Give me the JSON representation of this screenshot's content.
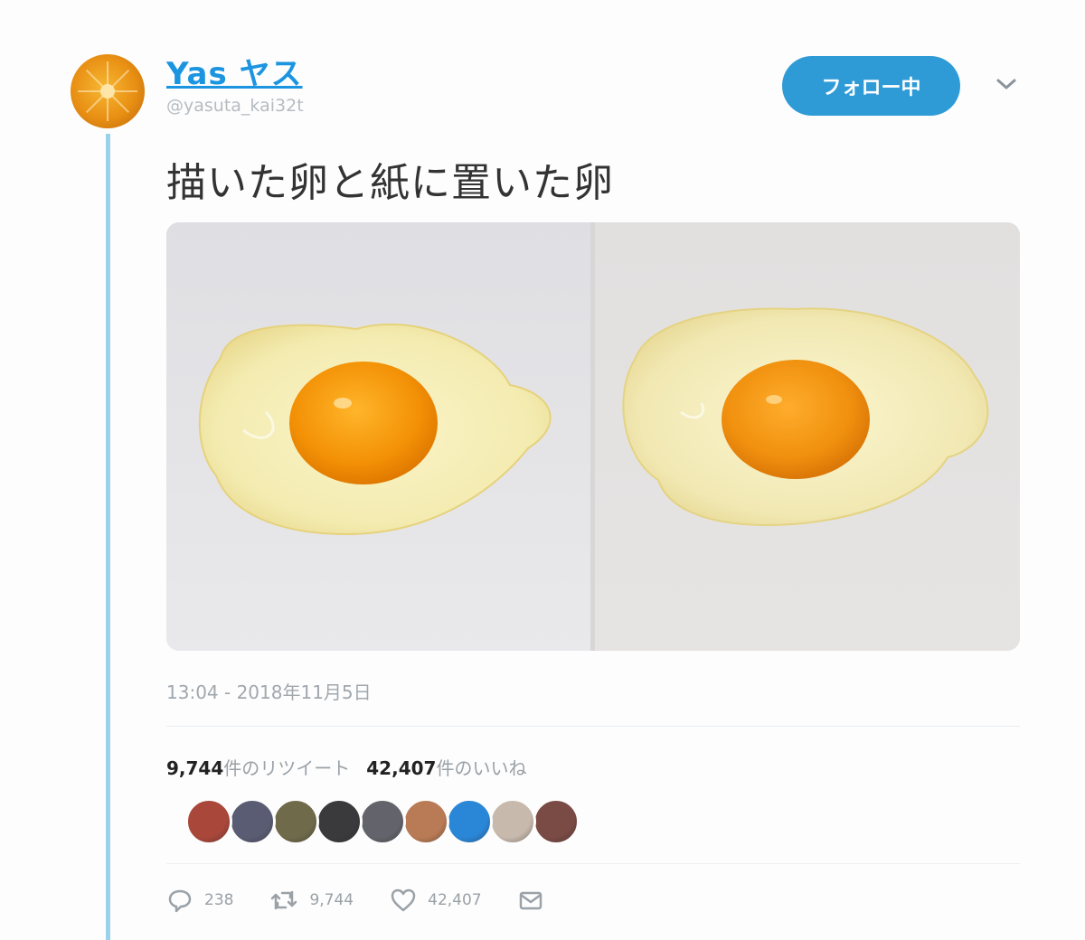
{
  "tweet": {
    "display_name": "Yas ヤス",
    "handle": "@yasuta_kai32t",
    "follow_label": "フォロー中",
    "text": "描いた卵と紙に置いた卵",
    "timestamp": "13:04 - 2018年11月5日"
  },
  "stats": {
    "retweets_count": "9,744",
    "retweets_suffix": "件のリツイート",
    "likes_count": "42,407",
    "likes_suffix": "件のいいね"
  },
  "likers": [
    {
      "color": "#a9473a"
    },
    {
      "color": "#5a5c73"
    },
    {
      "color": "#6f6a4a"
    },
    {
      "color": "#3a3a3d"
    },
    {
      "color": "#63646b"
    },
    {
      "color": "#b97b55"
    },
    {
      "color": "#2a86d6"
    },
    {
      "color": "#c8b9ad"
    },
    {
      "color": "#7a4a44"
    }
  ],
  "actions": {
    "replies": "238",
    "retweets": "9,744",
    "likes": "42,407"
  },
  "colors": {
    "accent": "#1b95e0",
    "follow_button": "#2f9bd6",
    "thread_line": "#9bd2ea",
    "yolk": "#f39c12"
  },
  "icons": {
    "reply": "reply-icon",
    "retweet": "retweet-icon",
    "like": "heart-icon",
    "message": "envelope-icon",
    "more": "chevron-down-icon"
  }
}
